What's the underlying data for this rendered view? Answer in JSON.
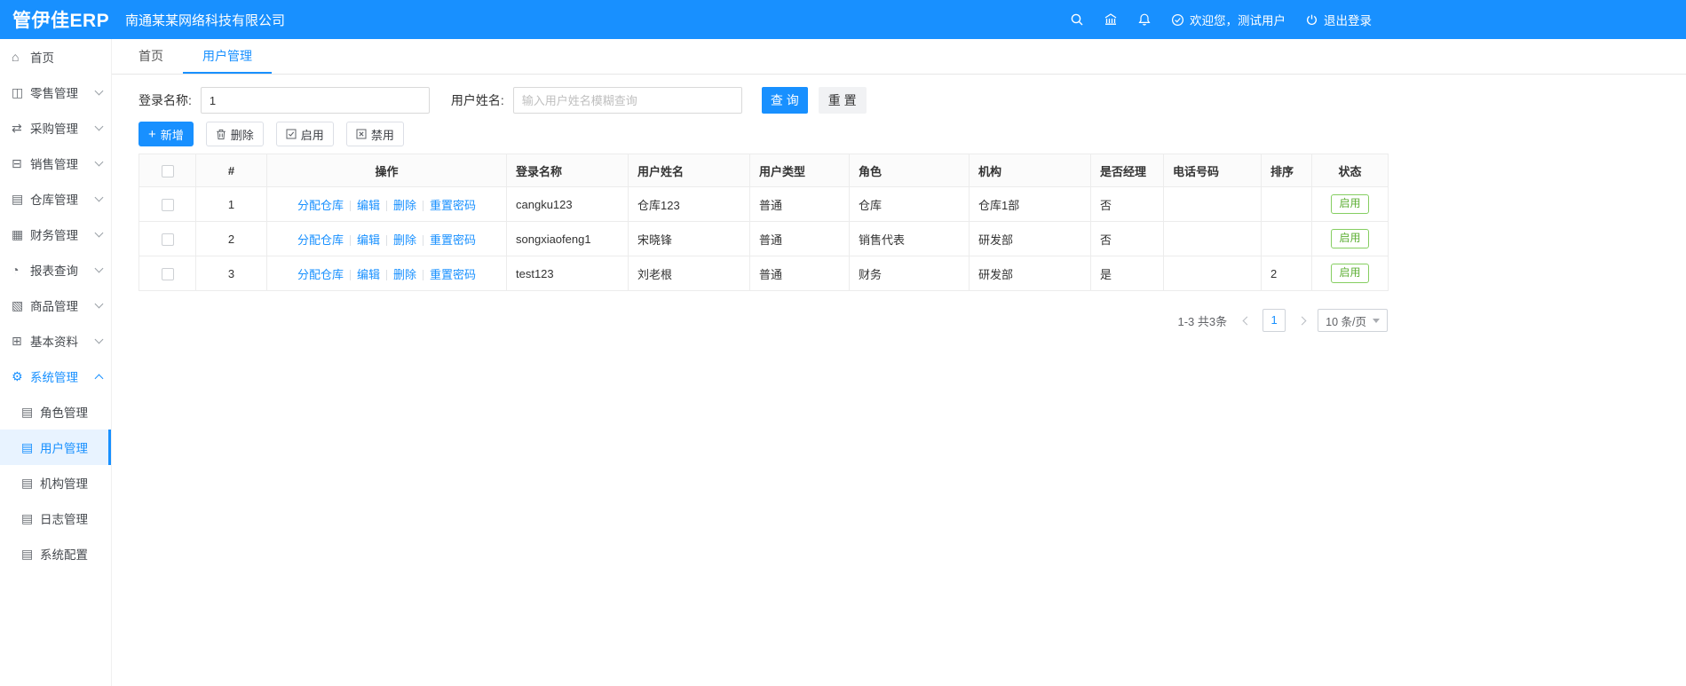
{
  "header": {
    "logo": "管伊佳ERP",
    "company": "南通某某网络科技有限公司",
    "welcome": "欢迎您，测试用户",
    "logout": "退出登录"
  },
  "icons": {
    "plus": "+",
    "home": "⌂",
    "retail": "◫",
    "purchase": "⇄",
    "sales": "⊟",
    "warehouse": "▤",
    "finance": "▦",
    "report": "◔",
    "product": "▧",
    "basic": "⊞",
    "system": "⚙",
    "submenu": "▤"
  },
  "sidebar": {
    "items": [
      {
        "label": "首页"
      },
      {
        "label": "零售管理"
      },
      {
        "label": "采购管理"
      },
      {
        "label": "销售管理"
      },
      {
        "label": "仓库管理"
      },
      {
        "label": "财务管理"
      },
      {
        "label": "报表查询"
      },
      {
        "label": "商品管理"
      },
      {
        "label": "基本资料"
      },
      {
        "label": "系统管理"
      }
    ],
    "system_children": [
      {
        "label": "角色管理"
      },
      {
        "label": "用户管理"
      },
      {
        "label": "机构管理"
      },
      {
        "label": "日志管理"
      },
      {
        "label": "系统配置"
      }
    ]
  },
  "tabs": [
    {
      "label": "首页"
    },
    {
      "label": "用户管理"
    }
  ],
  "search": {
    "login_label": "登录名称:",
    "login_value": "1",
    "name_label": "用户姓名:",
    "name_placeholder": "输入用户姓名模糊查询",
    "query_button": "查 询",
    "reset_button": "重 置"
  },
  "toolbar": {
    "add": "新增",
    "delete": "删除",
    "enable": "启用",
    "disable": "禁用"
  },
  "table": {
    "headers": [
      "#",
      "操作",
      "登录名称",
      "用户姓名",
      "用户类型",
      "角色",
      "机构",
      "是否经理",
      "电话号码",
      "排序",
      "状态"
    ],
    "action_links": [
      "分配仓库",
      "编辑",
      "删除",
      "重置密码"
    ],
    "rows": [
      {
        "index": "1",
        "login": "cangku123",
        "name": "仓库123",
        "type": "普通",
        "role": "仓库",
        "org": "仓库1部",
        "manager": "否",
        "phone": "",
        "sort": "",
        "status": "启用"
      },
      {
        "index": "2",
        "login": "songxiaofeng1",
        "name": "宋晓锋",
        "type": "普通",
        "role": "销售代表",
        "org": "研发部",
        "manager": "否",
        "phone": "",
        "sort": "",
        "status": "启用"
      },
      {
        "index": "3",
        "login": "test123",
        "name": "刘老根",
        "type": "普通",
        "role": "财务",
        "org": "研发部",
        "manager": "是",
        "phone": "",
        "sort": "2",
        "status": "启用"
      }
    ]
  },
  "pagination": {
    "summary": "1-3 共3条",
    "current_page": "1",
    "page_size": "10 条/页"
  },
  "colors": {
    "primary": "#1890ff",
    "success": "#5daf34"
  }
}
